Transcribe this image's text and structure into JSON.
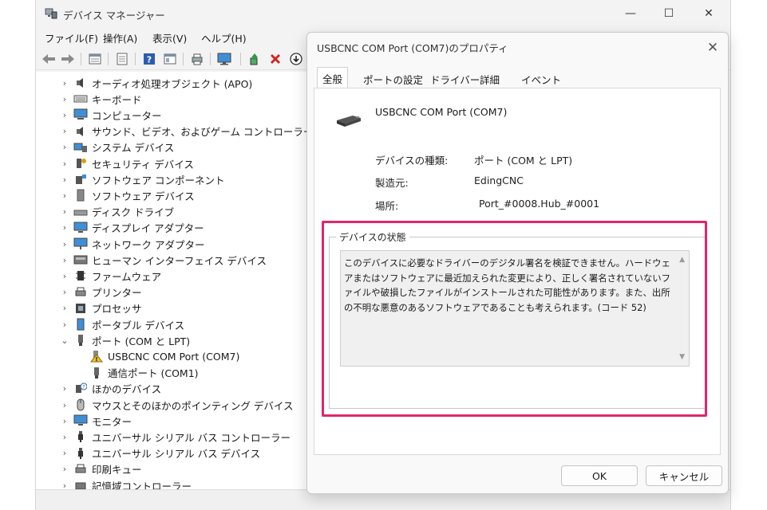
{
  "window": {
    "title": "デバイス マネージャー",
    "controls": {
      "minimize": "—",
      "maximize": "☐",
      "close": "✕"
    }
  },
  "menu": [
    "ファイル(F)",
    "操作(A)",
    "表示(V)",
    "ヘルプ(H)"
  ],
  "toolbar_icons": [
    "back-icon",
    "forward-icon",
    "properties-icon",
    "refresh-icon",
    "help-icon",
    "view-icon",
    "print-icon",
    "monitor-icon",
    "update-driver-icon",
    "uninstall-icon",
    "download-icon"
  ],
  "tree": {
    "items": [
      {
        "label": "オーディオ処理オブジェクト (APO)",
        "icon": "speaker",
        "expand": "›",
        "child": false
      },
      {
        "label": "キーボード",
        "icon": "keyboard",
        "expand": "›",
        "child": false
      },
      {
        "label": "コンピューター",
        "icon": "computer",
        "expand": "›",
        "child": false
      },
      {
        "label": "サウンド、ビデオ、およびゲーム コントローラー",
        "icon": "speaker",
        "expand": "›",
        "child": false
      },
      {
        "label": "システム デバイス",
        "icon": "system",
        "expand": "›",
        "child": false
      },
      {
        "label": "セキュリティ デバイス",
        "icon": "security",
        "expand": "›",
        "child": false
      },
      {
        "label": "ソフトウェア コンポーネント",
        "icon": "component",
        "expand": "›",
        "child": false
      },
      {
        "label": "ソフトウェア デバイス",
        "icon": "tower",
        "expand": "›",
        "child": false
      },
      {
        "label": "ディスク ドライブ",
        "icon": "disk",
        "expand": "›",
        "child": false
      },
      {
        "label": "ディスプレイ アダプター",
        "icon": "display",
        "expand": "›",
        "child": false
      },
      {
        "label": "ネットワーク アダプター",
        "icon": "network",
        "expand": "›",
        "child": false
      },
      {
        "label": "ヒューマン インターフェイス デバイス",
        "icon": "hid",
        "expand": "›",
        "child": false
      },
      {
        "label": "ファームウェア",
        "icon": "chip",
        "expand": "›",
        "child": false
      },
      {
        "label": "プリンター",
        "icon": "printer",
        "expand": "›",
        "child": false
      },
      {
        "label": "プロセッサ",
        "icon": "cpu",
        "expand": "›",
        "child": false
      },
      {
        "label": "ポータブル デバイス",
        "icon": "portable",
        "expand": "›",
        "child": false
      },
      {
        "label": "ポート (COM と LPT)",
        "icon": "port",
        "expand": "⌄",
        "child": false
      },
      {
        "label": "USBCNC COM Port (COM7)",
        "icon": "warning",
        "expand": "",
        "child": true
      },
      {
        "label": "通信ポート (COM1)",
        "icon": "port",
        "expand": "",
        "child": true
      },
      {
        "label": "ほかのデバイス",
        "icon": "unknown",
        "expand": "›",
        "child": false
      },
      {
        "label": "マウスとそのほかのポインティング デバイス",
        "icon": "mouse",
        "expand": "›",
        "child": false
      },
      {
        "label": "モニター",
        "icon": "display",
        "expand": "›",
        "child": false
      },
      {
        "label": "ユニバーサル シリアル バス コントローラー",
        "icon": "usb",
        "expand": "›",
        "child": false
      },
      {
        "label": "ユニバーサル シリアル バス デバイス",
        "icon": "usb",
        "expand": "›",
        "child": false
      },
      {
        "label": "印刷キュー",
        "icon": "printer",
        "expand": "›",
        "child": false
      },
      {
        "label": "記憶域コントローラー",
        "icon": "storage",
        "expand": "›",
        "child": false
      }
    ]
  },
  "dialog": {
    "title": "USBCNC COM Port (COM7)のプロパティ",
    "close": "✕",
    "tabs": [
      "全般",
      "ポートの設定",
      "ドライバー",
      "詳細",
      "イベント"
    ],
    "device_name": "USBCNC COM Port (COM7)",
    "properties": [
      {
        "label": "デバイスの種類:",
        "value": "ポート (COM と LPT)"
      },
      {
        "label": "製造元:",
        "value": "EdingCNC"
      },
      {
        "label": "場所:",
        "value": "Port_#0008.Hub_#0001"
      }
    ],
    "status_group_label": "デバイスの状態",
    "status_text": "このデバイスに必要なドライバーのデジタル署名を検証できません。ハードウェアまたはソフトウェアに最近加えられた変更により、正しく署名されていないファイルや破損したファイルがインストールされた可能性があります。また、出所の不明な悪意のあるソフトウェアであることも考えられます。(コード 52)",
    "scroll_up": "▲",
    "scroll_down": "▼",
    "ok_label": "OK",
    "cancel_label": "キャンセル"
  },
  "colors": {
    "highlight": "#e0266b",
    "uninstall_red": "#d42020",
    "accent_blue": "#2a7fd4"
  }
}
